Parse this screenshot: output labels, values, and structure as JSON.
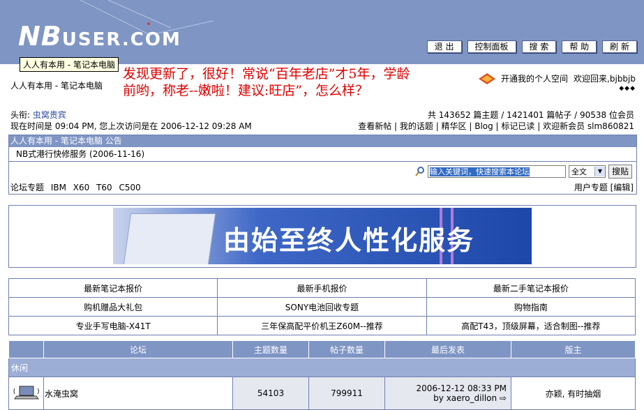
{
  "header": {
    "logo_big": "NB",
    "logo_rest": "USER.COM",
    "buttons": [
      "退 出",
      "控制面板",
      "搜 索",
      "帮 助",
      "刷 新"
    ]
  },
  "tooltip": "人人有本用 - 笔记本电脑",
  "site_name": "人人有本用 - 笔记本电脑",
  "announcement": "发现更新了，很好！常说“百年老店”才5年，学龄前哟，称老--嫩啦！建议:旺店”，怎么样？",
  "user_area": {
    "space_link": "开通我的个人空间",
    "welcome": "欢迎回来,bjbbjb",
    "arrows": "◆◆◆"
  },
  "headline": {
    "label": "头衔:",
    "value": "虫窝贵宾"
  },
  "stats": "共 143652 篇主题 / 1421401 篇帖子 / 90538 位会员",
  "timeline": "现在时间是 09:04 PM, 您上次访问是在 2006-12-12 09:28 AM",
  "user_links": "查看新帖 | 我的话题 | 精华区 | Blog | 标记已读 | 欢迎新会员 slm860821",
  "notice": {
    "title": "人人有本用 - 笔记本电脑 公告",
    "item": "NB式港行快修服务 (2006-11-16)"
  },
  "search": {
    "placeholder": "输入关键词，快速搜索本论坛",
    "scope": "全文",
    "button": "搜贴"
  },
  "topics": {
    "label": "论坛专题",
    "items": "IBM X60 T60 C500"
  },
  "user_topic": "用户专题 [编辑]",
  "banner_text": "由始至终人性化服务",
  "links": [
    [
      "最新笔记本报价",
      "最新手机报价",
      "最新二手笔记本报价"
    ],
    [
      "购机赠品大礼包",
      "SONY电池回收专题",
      "购物指南"
    ],
    [
      "专业手写电脑-X41T",
      "三年保高配平价机王Z60M--推荐",
      "高配T43，顶级屏幕，适合制图--推荐"
    ]
  ],
  "forum": {
    "headers": [
      "论坛",
      "主题数量",
      "帖子数量",
      "最后发表",
      "版主"
    ],
    "category": "休闲",
    "rows": [
      {
        "name": "水淹虫窝",
        "topics": "54103",
        "posts": "799911",
        "last_time": "2006-12-12 08:33 PM",
        "last_by": "by xaero_dillon",
        "mods": "亦颖, 有时抽烟"
      }
    ]
  },
  "colors": {
    "header_bg": "#7f95c4",
    "announcement": "#e00000"
  }
}
